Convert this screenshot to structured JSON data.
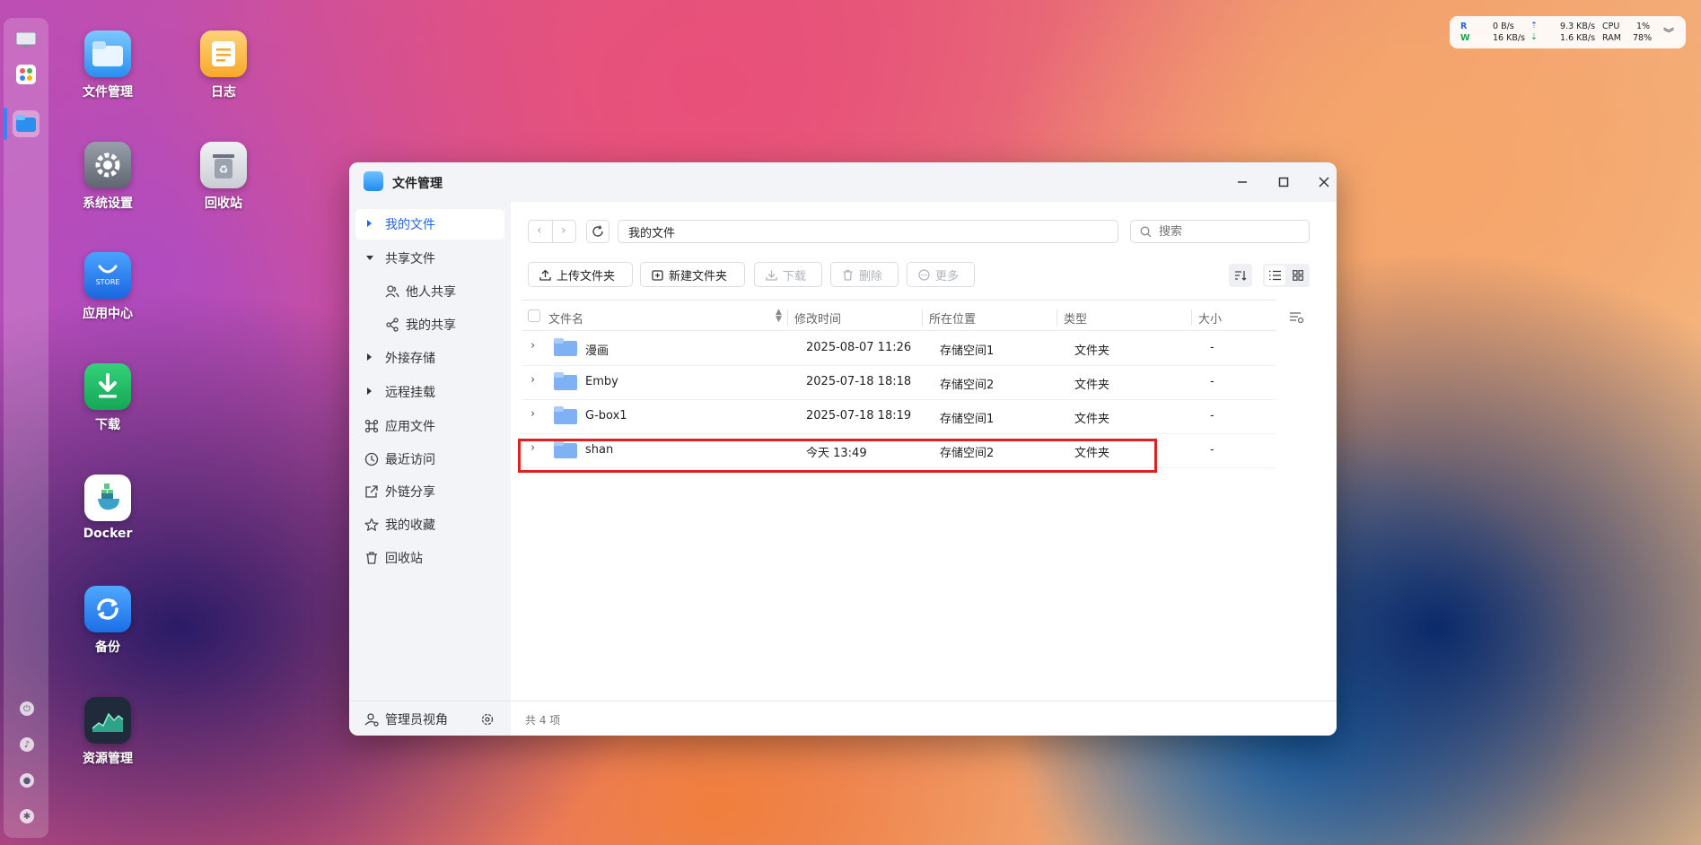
{
  "desktop": {
    "icons": [
      {
        "label": "文件管理"
      },
      {
        "label": "日志"
      },
      {
        "label": "系统设置"
      },
      {
        "label": "回收站"
      },
      {
        "label": "应用中心"
      },
      {
        "label": "下载"
      },
      {
        "label": "Docker"
      },
      {
        "label": "备份"
      },
      {
        "label": "资源管理"
      }
    ],
    "store_text": "STORE"
  },
  "netwidget": {
    "r_label": "R",
    "w_label": "W",
    "r_speed": "0   B/s",
    "w_speed": "16 KB/s",
    "up_speed": "9.3 KB/s",
    "down_speed": "1.6 KB/s",
    "cpu_label": "CPU",
    "cpu_value": "1%",
    "ram_label": "RAM",
    "ram_value": "78%"
  },
  "window": {
    "title": "文件管理",
    "sidebar": {
      "items": [
        {
          "label": "我的文件"
        },
        {
          "label": "共享文件"
        },
        {
          "label": "他人共享"
        },
        {
          "label": "我的共享"
        },
        {
          "label": "外接存储"
        },
        {
          "label": "远程挂载"
        },
        {
          "label": "应用文件"
        },
        {
          "label": "最近访问"
        },
        {
          "label": "外链分享"
        },
        {
          "label": "我的收藏"
        },
        {
          "label": "回收站"
        }
      ],
      "admin_label": "管理员视角"
    },
    "path": "我的文件",
    "search_placeholder": "搜索",
    "toolbar": {
      "upload": "上传文件夹",
      "new_folder": "新建文件夹",
      "download": "下载",
      "delete": "删除",
      "more": "更多"
    },
    "columns": [
      "文件名",
      "修改时间",
      "所在位置",
      "类型",
      "大小"
    ],
    "rows": [
      {
        "name": "漫画",
        "modified": "2025-08-07 11:26",
        "location": "存储空间1",
        "type": "文件夹",
        "size": "-"
      },
      {
        "name": "Emby",
        "modified": "2025-07-18 18:18",
        "location": "存储空间2",
        "type": "文件夹",
        "size": "-"
      },
      {
        "name": "G-box1",
        "modified": "2025-07-18 18:19",
        "location": "存储空间1",
        "type": "文件夹",
        "size": "-"
      },
      {
        "name": "shan",
        "modified": "今天 13:49",
        "location": "存储空间2",
        "type": "文件夹",
        "size": "-"
      }
    ],
    "status": "共 4 项"
  },
  "colors": {
    "accent": "#2563eb",
    "highlight": "#e02020",
    "folder": "#7fb2f5"
  }
}
